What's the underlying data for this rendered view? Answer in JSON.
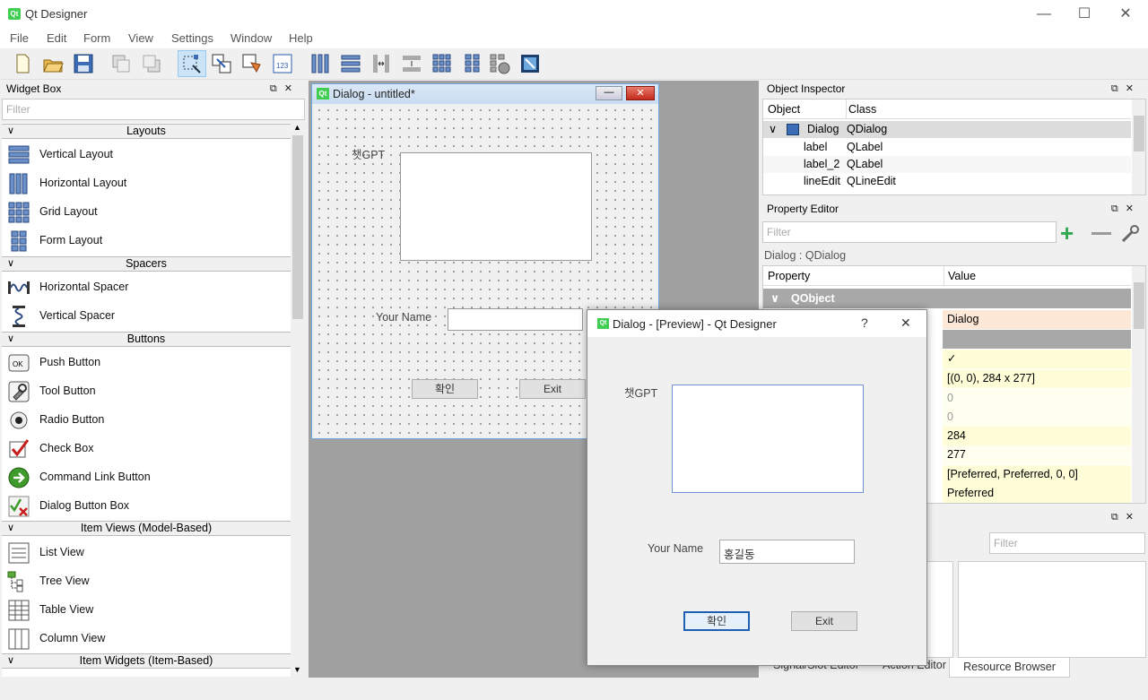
{
  "app": {
    "title": "Qt Designer",
    "icon": "Qt"
  },
  "menu": [
    "File",
    "Edit",
    "Form",
    "View",
    "Settings",
    "Window",
    "Help"
  ],
  "widget_box": {
    "title": "Widget Box",
    "filter_placeholder": "Filter",
    "categories": [
      {
        "name": "Layouts",
        "items": [
          "Vertical Layout",
          "Horizontal Layout",
          "Grid Layout",
          "Form Layout"
        ]
      },
      {
        "name": "Spacers",
        "items": [
          "Horizontal Spacer",
          "Vertical Spacer"
        ]
      },
      {
        "name": "Buttons",
        "items": [
          "Push Button",
          "Tool Button",
          "Radio Button",
          "Check Box",
          "Command Link Button",
          "Dialog Button Box"
        ]
      },
      {
        "name": "Item Views (Model-Based)",
        "items": [
          "List View",
          "Tree View",
          "Table View",
          "Column View"
        ]
      },
      {
        "name": "Item Widgets (Item-Based)",
        "items": []
      }
    ]
  },
  "form_window": {
    "title": "Dialog - untitled*",
    "label1": "챗GPT",
    "label2": "Your Name",
    "ok_button": "확인",
    "exit_button": "Exit"
  },
  "object_inspector": {
    "title": "Object Inspector",
    "col_object": "Object",
    "col_class": "Class",
    "rows": [
      {
        "object": "Dialog",
        "class": "QDialog"
      },
      {
        "object": "label",
        "class": "QLabel"
      },
      {
        "object": "label_2",
        "class": "QLabel"
      },
      {
        "object": "lineEdit",
        "class": "QLineEdit"
      }
    ]
  },
  "property_editor": {
    "title": "Property Editor",
    "filter_placeholder": "Filter",
    "context": "Dialog : QDialog",
    "col_property": "Property",
    "col_value": "Value",
    "group": "QObject",
    "values": [
      "Dialog",
      "",
      "✓",
      "[(0, 0), 284 x 277]",
      "0",
      "0",
      "284",
      "277",
      "[Preferred, Preferred, 0, 0]",
      "Preferred"
    ]
  },
  "resource_panel": {
    "filter_placeholder": "Filter",
    "tabs": [
      "Signal/Slot Editor",
      "Action Editor",
      "Resource Browser"
    ]
  },
  "preview": {
    "title": "Dialog - [Preview] - Qt Designer",
    "help": "?",
    "close": "✕",
    "label1": "챗GPT",
    "label2": "Your Name",
    "name_value": "홍길동",
    "ok_button": "확인",
    "exit_button": "Exit"
  }
}
